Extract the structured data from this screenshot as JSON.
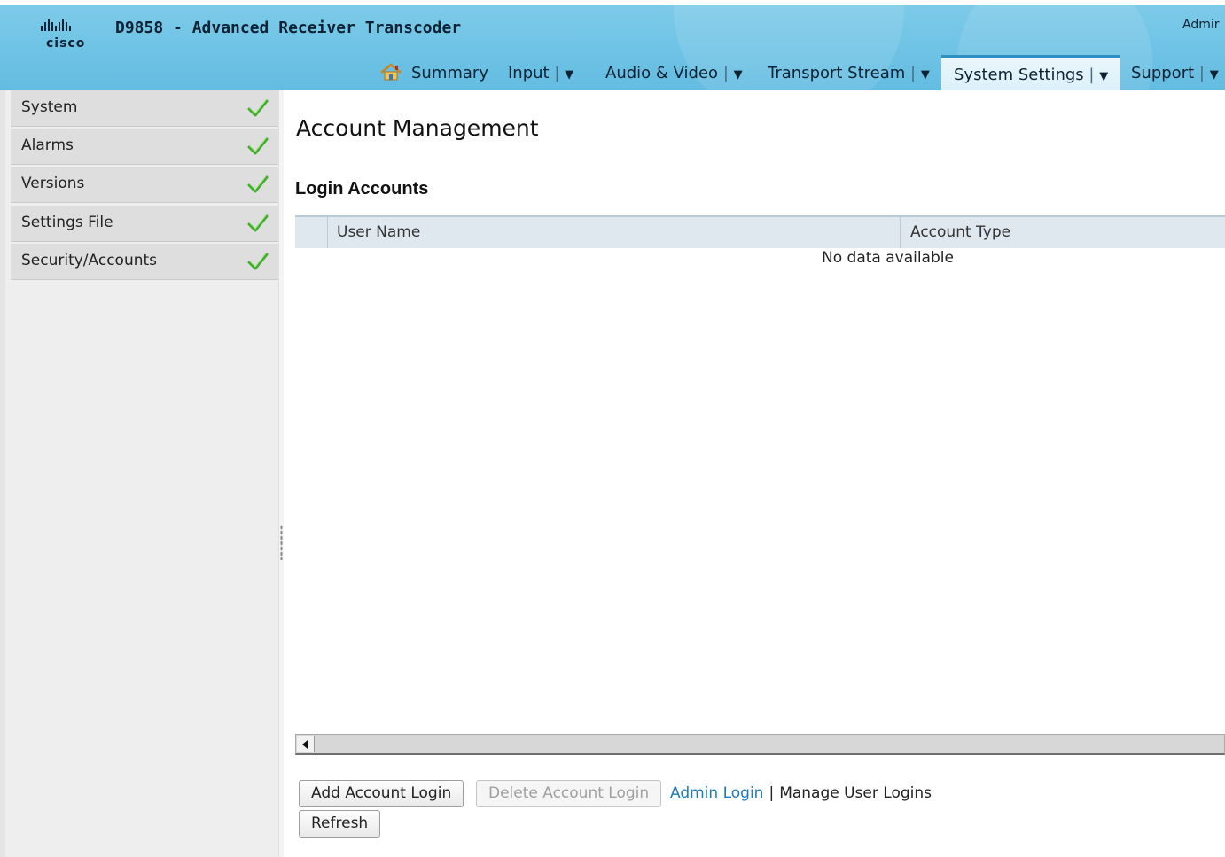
{
  "header": {
    "logo_text": "cisco",
    "title": "D9858 - Advanced Receiver Transcoder",
    "user": "Admir"
  },
  "nav": {
    "items": [
      {
        "label": "Summary",
        "icon": "home-icon",
        "has_menu": false
      },
      {
        "label": "Input",
        "has_menu": true
      },
      {
        "label": "Audio & Video",
        "has_menu": true
      },
      {
        "label": "Transport Stream",
        "has_menu": true
      },
      {
        "label": "System Settings",
        "has_menu": true,
        "active": true
      },
      {
        "label": "Support",
        "has_menu": true
      }
    ],
    "separator": "|",
    "menu_arrow": "▼"
  },
  "sidebar": {
    "items": [
      {
        "label": "System",
        "status": "ok"
      },
      {
        "label": "Alarms",
        "status": "ok"
      },
      {
        "label": "Versions",
        "status": "ok"
      },
      {
        "label": "Settings File",
        "status": "ok"
      },
      {
        "label": "Security/Accounts",
        "status": "ok"
      }
    ]
  },
  "main": {
    "page_title": "Account Management",
    "section_title": "Login Accounts",
    "table": {
      "columns": [
        "User Name",
        "Account Type"
      ],
      "rows": [],
      "empty_text": "No data available"
    },
    "buttons": {
      "add": "Add Account Login",
      "delete": "Delete Account Login",
      "refresh": "Refresh"
    },
    "links": {
      "admin_login": "Admin Login",
      "separator": "|",
      "manage_user_logins": "Manage User Logins"
    }
  },
  "colors": {
    "header_blue": "#6fc3e5",
    "link_blue": "#1a7bbf",
    "check_green": "#3fae2a"
  }
}
